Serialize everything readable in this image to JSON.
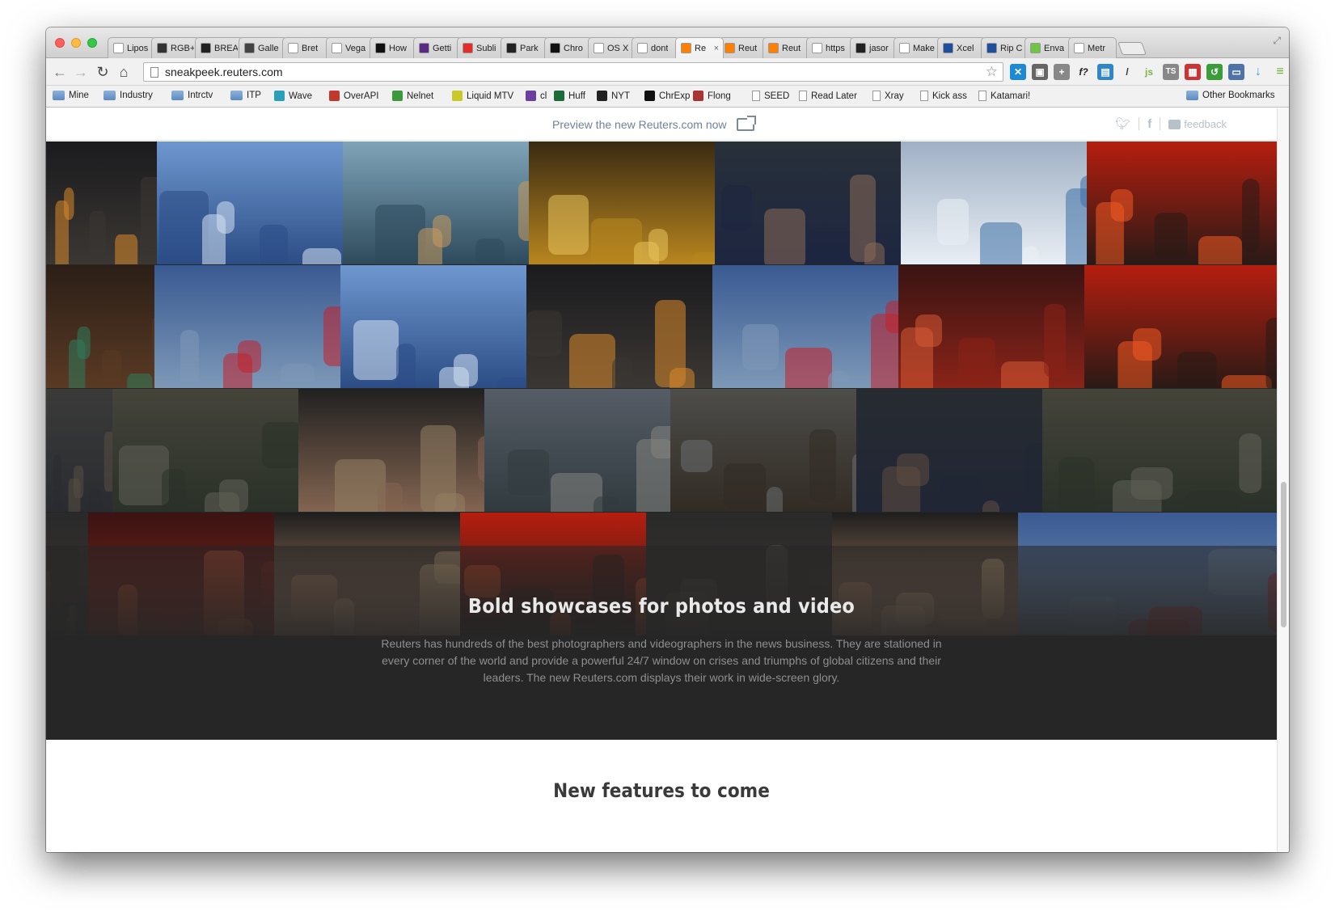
{
  "browser": {
    "tabs": [
      {
        "label": "Lipos",
        "icon": "page-icon",
        "color": "#ffffff"
      },
      {
        "label": "RGB+",
        "icon": "rgb-icon",
        "color": "#333333"
      },
      {
        "label": "BREA",
        "icon": "b-icon",
        "color": "#222222"
      },
      {
        "label": "Galle",
        "icon": "github-icon",
        "color": "#444444"
      },
      {
        "label": "Bret",
        "icon": "x-icon",
        "color": "#ffffff"
      },
      {
        "label": "Vega",
        "icon": "vega-icon",
        "color": "#ffffff"
      },
      {
        "label": "How",
        "icon": "d-icon",
        "color": "#111111"
      },
      {
        "label": "Getti",
        "icon": "b-icon",
        "color": "#5a2a82"
      },
      {
        "label": "Subli",
        "icon": "youtube-icon",
        "color": "#e52d27"
      },
      {
        "label": "Park",
        "icon": "park-icon",
        "color": "#222222"
      },
      {
        "label": "Chro",
        "icon": "ce-icon",
        "color": "#111111"
      },
      {
        "label": "OS X",
        "icon": "apple-icon",
        "color": "#ffffff"
      },
      {
        "label": "dont",
        "icon": "gmail-icon",
        "color": "#ffffff"
      },
      {
        "label": "Re",
        "icon": "reuters-icon",
        "color": "#ff8000",
        "active": true
      },
      {
        "label": "Reut",
        "icon": "reuters-icon",
        "color": "#ff8000"
      },
      {
        "label": "Reut",
        "icon": "reuters-icon",
        "color": "#ff8000"
      },
      {
        "label": "https",
        "icon": "page-icon",
        "color": "#ffffff"
      },
      {
        "label": "jasor",
        "icon": "idea-icon",
        "color": "#222222"
      },
      {
        "label": "Make",
        "icon": "page-icon",
        "color": "#ffffff"
      },
      {
        "label": "Xcel",
        "icon": "s-icon",
        "color": "#1f4e9c"
      },
      {
        "label": "Rip C",
        "icon": "s-icon",
        "color": "#1f4e9c"
      },
      {
        "label": "Enva",
        "icon": "leaf-icon",
        "color": "#6cc644"
      },
      {
        "label": "Metr",
        "icon": "page-icon",
        "color": "#ffffff"
      }
    ],
    "active_tab_close": "×",
    "url": "sneakpeek.reuters.com",
    "bookmarks": [
      {
        "label": "Mine",
        "type": "folder"
      },
      {
        "label": "Industry",
        "type": "folder"
      },
      {
        "label": "Intrctv",
        "type": "folder"
      },
      {
        "label": "ITP",
        "type": "folder"
      },
      {
        "label": "Wave",
        "type": "wave"
      },
      {
        "label": "OverAPI",
        "type": "overapi"
      },
      {
        "label": "Nelnet",
        "type": "nelnet"
      },
      {
        "label": "Liquid MTV",
        "type": "mtv"
      },
      {
        "label": "cl",
        "type": "peace"
      },
      {
        "label": "Huff",
        "type": "huff"
      },
      {
        "label": "NYT",
        "type": "nyt"
      },
      {
        "label": "ChrExp",
        "type": "ce"
      },
      {
        "label": "Flong",
        "type": "flong"
      },
      {
        "label": "SEED",
        "type": "page"
      },
      {
        "label": "Read Later",
        "type": "page"
      },
      {
        "label": "Xray",
        "type": "page"
      },
      {
        "label": "Kick ass",
        "type": "page"
      },
      {
        "label": "Katamari!",
        "type": "page"
      }
    ],
    "other_bookmarks": "Other Bookmarks"
  },
  "page": {
    "preview_text": "Preview the new Reuters.com now",
    "feedback": "feedback",
    "showcase_title": "Bold showcases for photos and video",
    "showcase_body": "Reuters has hundreds of the best photographers and videographers in the news business. They are stationed in every corner of the world and provide a powerful 24/7 window on crises and triumphs of global citizens and their leaders. The new Reuters.com displays their work in wide-screen glory.",
    "features_title": "New features to come"
  },
  "colors": {
    "link": "#6f8396",
    "dark_band": "#262626",
    "heading_dark": "#3a3a3a",
    "heading_light": "#e9e9e9"
  }
}
